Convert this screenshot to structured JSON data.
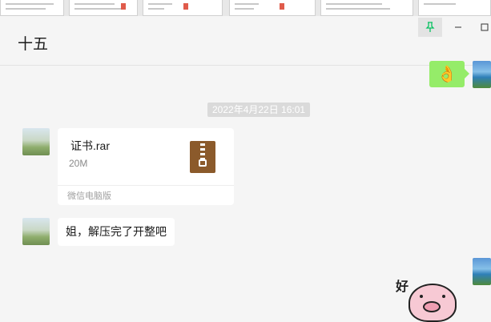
{
  "chat": {
    "title": "十五",
    "messages": [
      {
        "type": "sticker",
        "from": "me",
        "emoji": "👌"
      },
      {
        "type": "timestamp",
        "text": "2022年4月22日 16:01"
      },
      {
        "type": "file",
        "from": "other",
        "file_name": "证书.rar",
        "file_size": "20M",
        "source": "微信电脑版",
        "icon": "zip-file-icon"
      },
      {
        "type": "text",
        "from": "other",
        "text": "姐，解压完了开整吧"
      },
      {
        "type": "sticker",
        "from": "me",
        "sticker_text": "好"
      }
    ]
  },
  "window": {
    "pin_icon": "⚲",
    "minimize_icon": "—",
    "maximize_icon": "☐"
  },
  "colors": {
    "background": "#f5f5f5",
    "my_bubble": "#95ec69",
    "pin_accent": "#07c160"
  }
}
